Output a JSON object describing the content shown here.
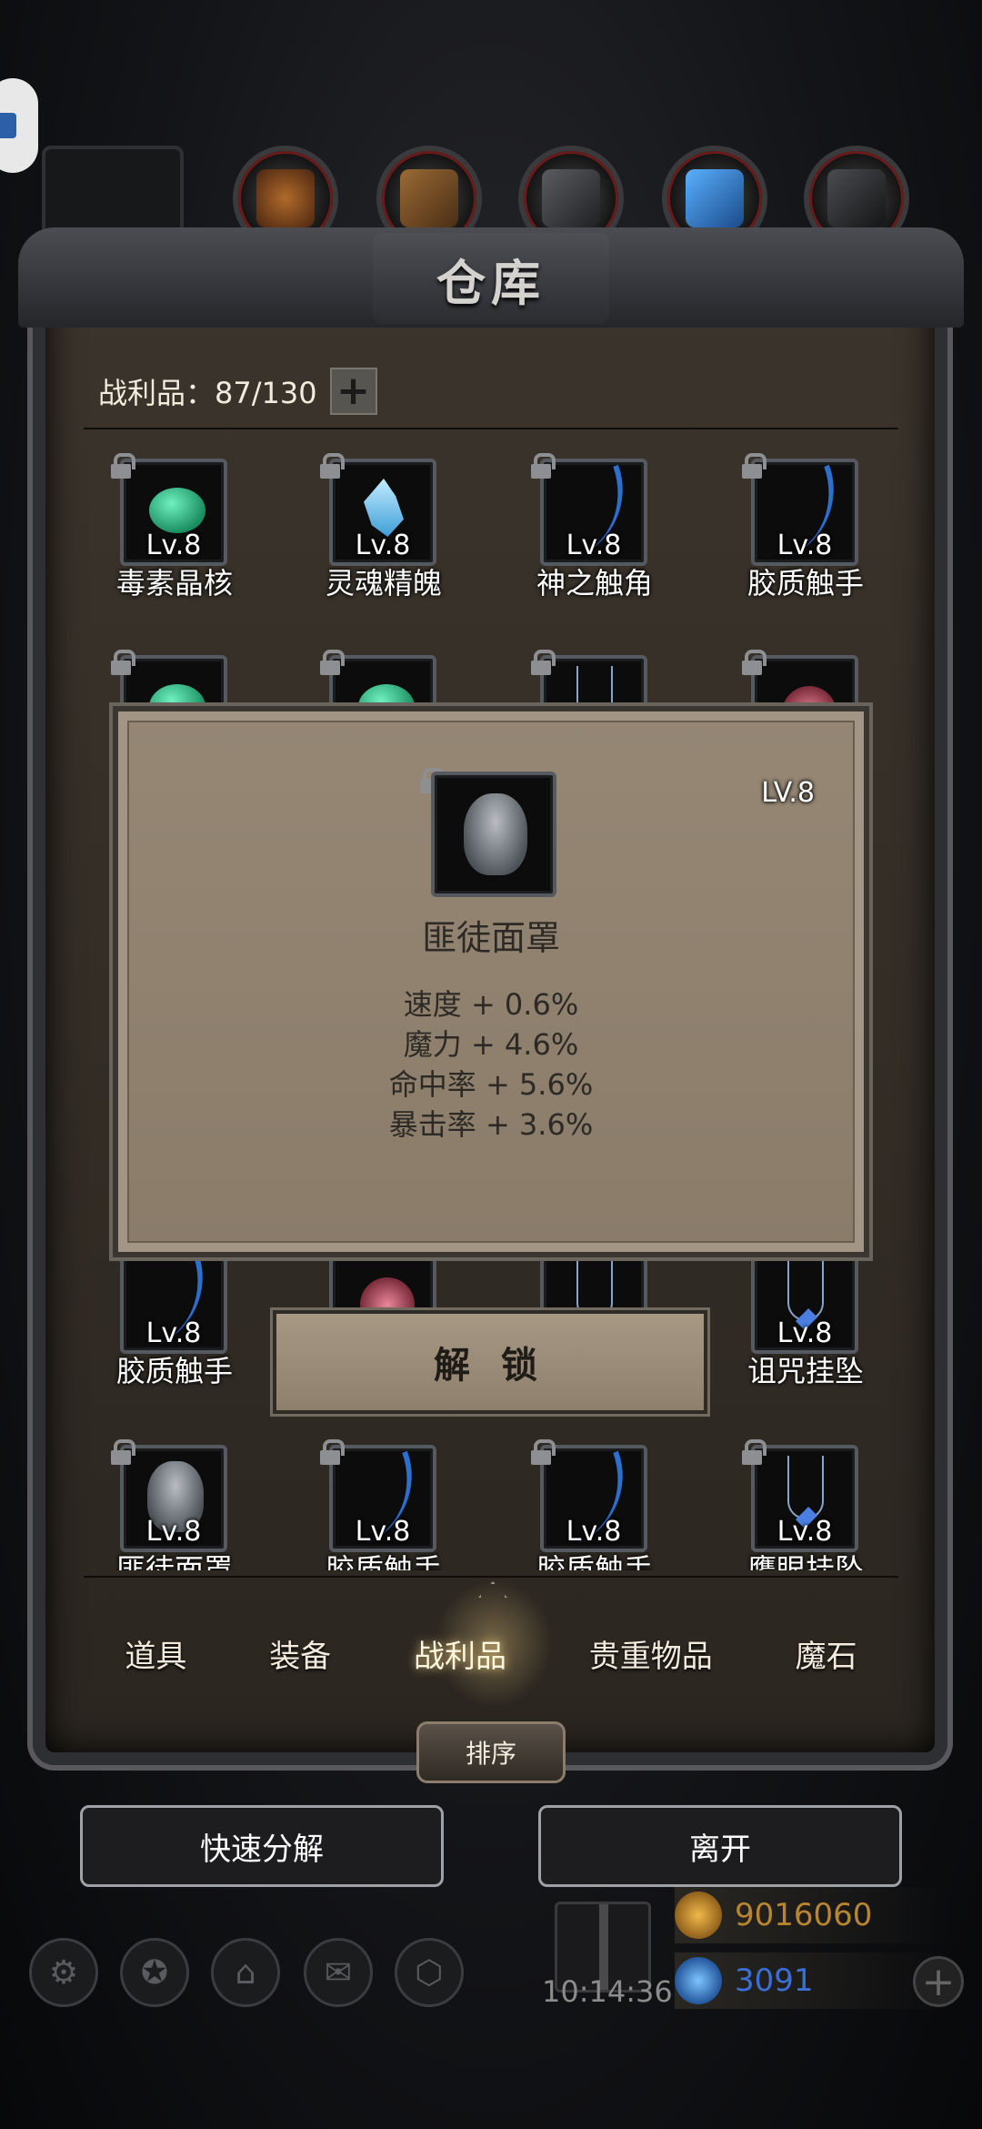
{
  "window": {
    "title": "仓库"
  },
  "header": {
    "count_label": "战利品：87/130",
    "plus_symbol": "+"
  },
  "grid": {
    "rows": [
      [
        {
          "name": "毒素晶核",
          "level": "Lv.8",
          "icon": "gem-icon"
        },
        {
          "name": "灵魂精魄",
          "level": "Lv.8",
          "icon": "soul-icon"
        },
        {
          "name": "神之触角",
          "level": "Lv.8",
          "icon": "tentacle-icon"
        },
        {
          "name": "胶质触手",
          "level": "Lv.8",
          "icon": "tentacle-icon"
        }
      ],
      [
        {
          "name": "胶质触手",
          "level": "Lv.8",
          "icon": "tentacle-icon"
        },
        {
          "name": "",
          "level": "",
          "icon": "feather-icon"
        },
        {
          "name": "",
          "level": "",
          "icon": "necklace-icon"
        },
        {
          "name": "诅咒挂坠",
          "level": "Lv.8",
          "icon": "necklace-icon"
        }
      ],
      [
        {
          "name": "匪徒面罩",
          "level": "Lv.8",
          "icon": "mask-icon"
        },
        {
          "name": "胶质触手",
          "level": "Lv.8",
          "icon": "tentacle-icon"
        },
        {
          "name": "胶质触手",
          "level": "Lv.8",
          "icon": "tentacle-icon"
        },
        {
          "name": "鹰眼挂坠",
          "level": "Lv.8",
          "icon": "necklace-icon"
        }
      ]
    ]
  },
  "tooltip": {
    "level": "LV.8",
    "name": "匪徒面罩",
    "stats": [
      "速度 + 0.6%",
      "魔力 + 4.6%",
      "命中率 + 5.6%",
      "暴击率 + 3.6%"
    ],
    "icon": "mask-icon"
  },
  "unlock_button": "解 锁",
  "tabs": [
    {
      "label": "道具",
      "active": false
    },
    {
      "label": "装备",
      "active": false
    },
    {
      "label": "战利品",
      "active": true
    },
    {
      "label": "贵重物品",
      "active": false
    },
    {
      "label": "魔石",
      "active": false
    }
  ],
  "sort_button": "排序",
  "actions": {
    "quick_dismantle": "快速分解",
    "leave": "离开"
  },
  "hud": {
    "time": "10:14:36",
    "gold": "9016060",
    "gems": "3091",
    "gold_color": "#b8862f",
    "gem_color": "#3a6fd6"
  }
}
